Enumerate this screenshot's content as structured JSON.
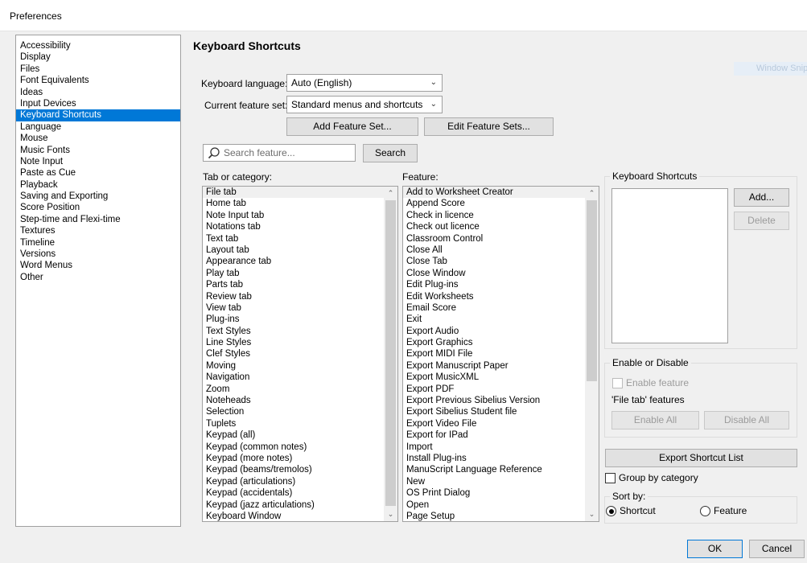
{
  "window": {
    "title": "Preferences"
  },
  "categories": {
    "items": [
      "Accessibility",
      "Display",
      "Files",
      "Font Equivalents",
      "Ideas",
      "Input Devices",
      "Keyboard Shortcuts",
      "Language",
      "Mouse",
      "Music Fonts",
      "Note Input",
      "Paste as Cue",
      "Playback",
      "Saving and Exporting",
      "Score Position",
      "Step-time and Flexi-time",
      "Textures",
      "Timeline",
      "Versions",
      "Word Menus",
      "Other"
    ],
    "selected": "Keyboard Shortcuts"
  },
  "page": {
    "title": "Keyboard Shortcuts",
    "window_snip_label": "Window Snip",
    "keyboard_language_label": "Keyboard language:",
    "keyboard_language_value": "Auto (English)",
    "feature_set_label": "Current feature set:",
    "feature_set_value": "Standard menus and shortcuts",
    "add_feature_set": "Add Feature Set...",
    "edit_feature_sets": "Edit Feature Sets...",
    "search_placeholder": "Search feature...",
    "search_button": "Search",
    "tab_category_label": "Tab or category:",
    "feature_label": "Feature:"
  },
  "tabs_list": {
    "items": [
      "File tab",
      "Home tab",
      "Note Input tab",
      "Notations tab",
      "Text tab",
      "Layout tab",
      "Appearance tab",
      "Play tab",
      "Parts tab",
      "Review tab",
      "View tab",
      "Plug-ins",
      "Text Styles",
      "Line Styles",
      "Clef Styles",
      "Moving",
      "Navigation",
      "Zoom",
      "Noteheads",
      "Selection",
      "Tuplets",
      "Keypad (all)",
      "Keypad (common notes)",
      "Keypad (more notes)",
      "Keypad (beams/tremolos)",
      "Keypad (articulations)",
      "Keypad (accidentals)",
      "Keypad (jazz articulations)",
      "Keyboard Window"
    ],
    "selected": "File tab"
  },
  "features_list": {
    "items": [
      "Add to Worksheet Creator",
      "Append Score",
      "Check in licence",
      "Check out licence",
      "Classroom Control",
      "Close All",
      "Close Tab",
      "Close Window",
      "Edit Plug-ins",
      "Edit Worksheets",
      "Email Score",
      "Exit",
      "Export Audio",
      "Export Graphics",
      "Export MIDI File",
      "Export Manuscript Paper",
      "Export MusicXML",
      "Export PDF",
      "Export Previous Sibelius Version",
      "Export Sibelius Student file",
      "Export Video File",
      "Export for IPad",
      "Import",
      "Install Plug-ins",
      "ManuScript Language Reference",
      "New",
      "OS Print Dialog",
      "Open",
      "Page Setup"
    ],
    "selected": "Add to Worksheet Creator"
  },
  "shortcuts_panel": {
    "title": "Keyboard Shortcuts",
    "add": "Add...",
    "delete": "Delete"
  },
  "enable_panel": {
    "title": "Enable or Disable",
    "enable_feature": "Enable feature",
    "features_caption": "'File tab' features",
    "enable_all": "Enable All",
    "disable_all": "Disable All"
  },
  "export_shortcut_list": "Export Shortcut List",
  "group_by_category": "Group by category",
  "sort": {
    "title": "Sort by:",
    "shortcut": "Shortcut",
    "feature": "Feature",
    "selected": "Shortcut"
  },
  "footer": {
    "ok": "OK",
    "cancel": "Cancel"
  },
  "colors": {
    "selection": "#0078d7",
    "accent_border": "#0078d7"
  }
}
